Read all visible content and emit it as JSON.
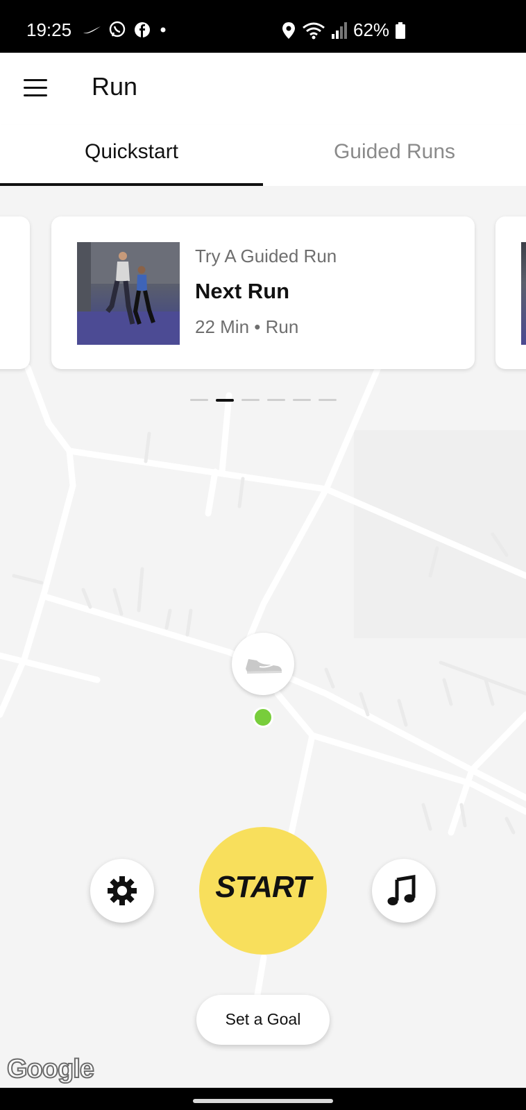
{
  "status_bar": {
    "time": "19:25",
    "battery": "62%"
  },
  "app_bar": {
    "title": "Run"
  },
  "tabs": [
    {
      "label": "Quickstart",
      "selected": true
    },
    {
      "label": "Guided Runs",
      "selected": false
    }
  ],
  "guided_card": {
    "subtitle": "Try A Guided Run",
    "title": "Next Run",
    "meta": "22 Min • Run"
  },
  "carousel": {
    "page_count": 6,
    "active_index": 1
  },
  "controls": {
    "start_label": "START",
    "goal_label": "Set a Goal",
    "start_color": "#f8df5c",
    "location_color": "#78cd3b"
  },
  "map": {
    "attribution": "Google"
  },
  "icons": [
    "menu-icon",
    "gear-icon",
    "music-note-icon",
    "shoe-icon",
    "location-pin-icon",
    "wifi-icon",
    "signal-icon",
    "battery-icon"
  ]
}
